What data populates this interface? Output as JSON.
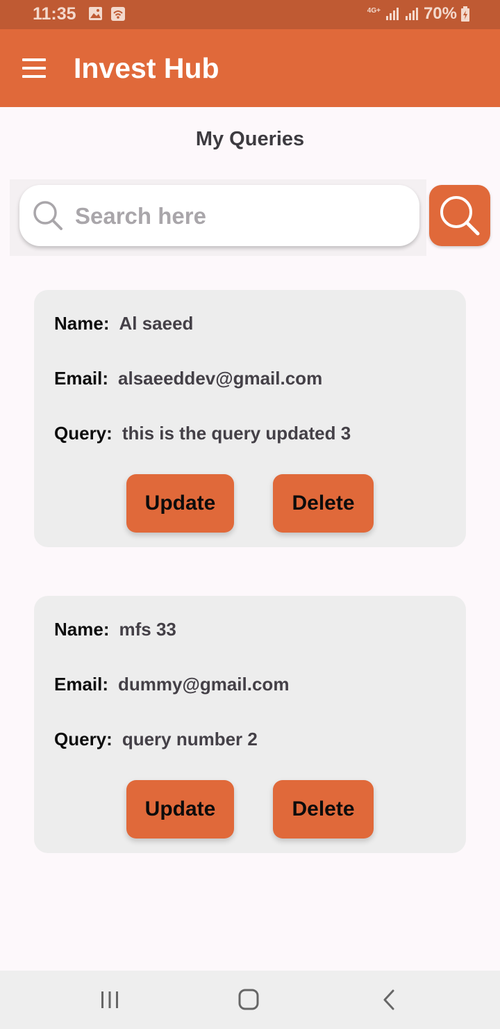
{
  "status_bar": {
    "time": "11:35",
    "network": "4G+",
    "battery": "70%"
  },
  "app_bar": {
    "title": "Invest Hub",
    "menu_icon": "hamburger-menu-icon"
  },
  "page": {
    "title": "My Queries"
  },
  "search": {
    "placeholder": "Search here",
    "value": ""
  },
  "labels": {
    "name": "Name:",
    "email": "Email:",
    "query": "Query:",
    "update": "Update",
    "delete": "Delete"
  },
  "queries": [
    {
      "name": "Al saeed",
      "email": "alsaeeddev@gmail.com",
      "query": "this is the query updated 3"
    },
    {
      "name": "mfs 33",
      "email": "dummy@gmail.com",
      "query": "query number 2"
    }
  ],
  "colors": {
    "primary": "#e0693a",
    "status_bar": "#bf5a33",
    "card": "#ededed",
    "background": "#fdf8fb"
  }
}
